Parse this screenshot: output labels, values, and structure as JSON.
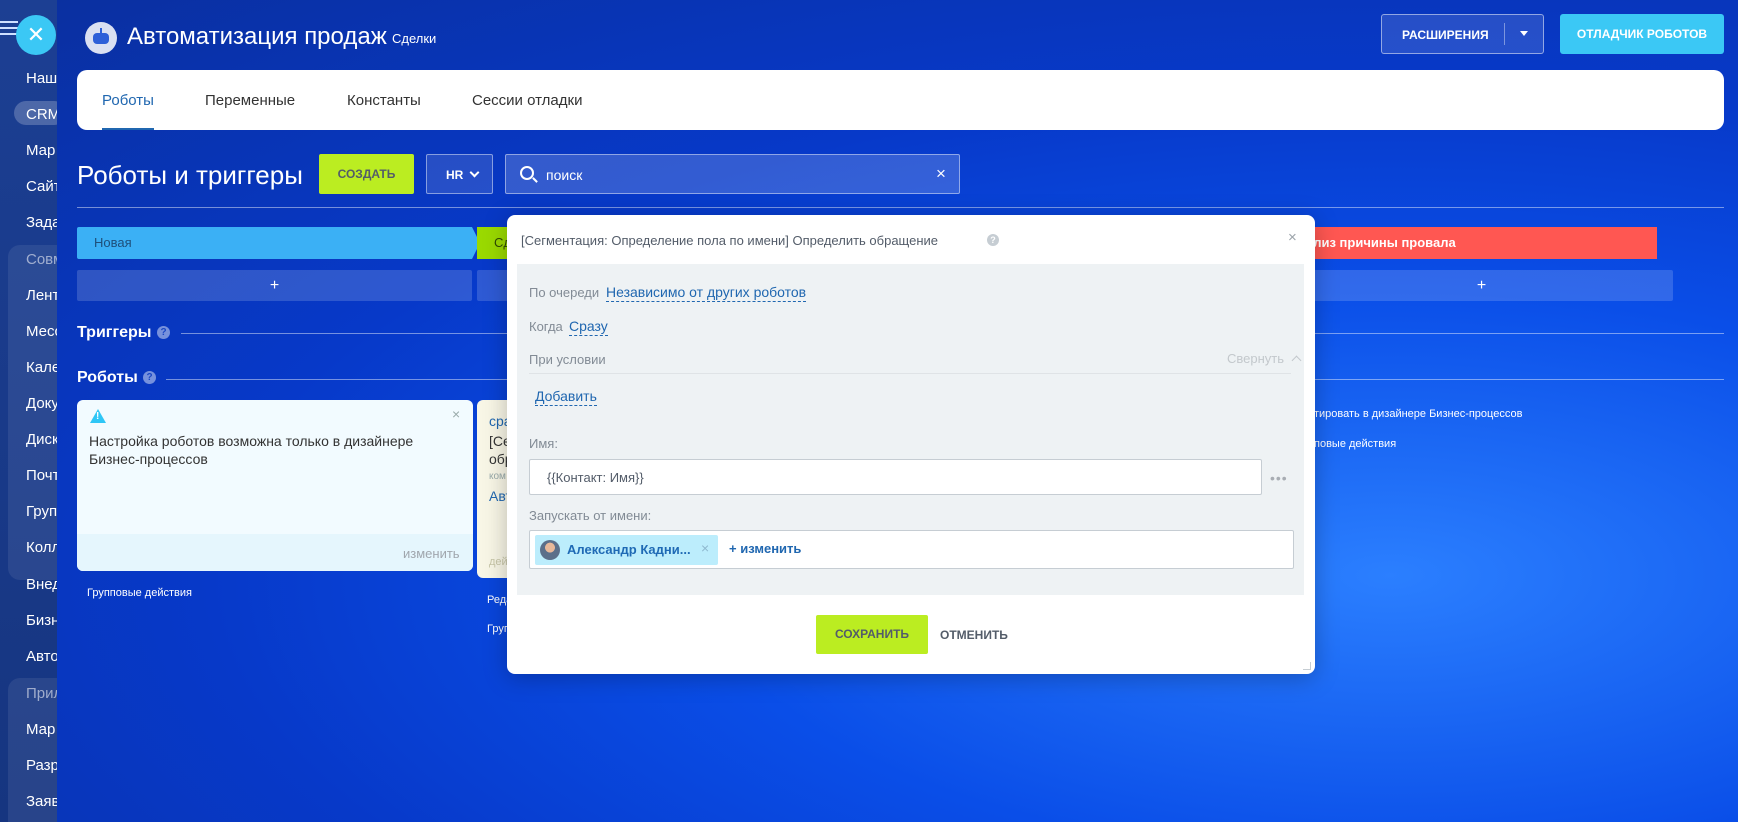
{
  "sidebar": {
    "items": [
      {
        "label": "Наш",
        "top": 0
      },
      {
        "label": "CRM"
      },
      {
        "label": "Мар"
      },
      {
        "label": "Сайт"
      },
      {
        "label": "Зада"
      },
      {
        "label": "Совм"
      },
      {
        "label": "Лент"
      },
      {
        "label": "Месс"
      },
      {
        "label": "Кале"
      },
      {
        "label": "Доку"
      },
      {
        "label": "Диск"
      },
      {
        "label": "Почт"
      },
      {
        "label": "Груп"
      },
      {
        "label": "Колл"
      },
      {
        "label": "Внед"
      },
      {
        "label": "Бизн"
      },
      {
        "label": "Авто"
      },
      {
        "label": "Прил"
      },
      {
        "label": "Мар"
      },
      {
        "label": "Разр"
      },
      {
        "label": "Заяв"
      }
    ]
  },
  "header": {
    "title": "Автоматизация продаж",
    "subtitle": "Сделки",
    "extensions_label": "РАСШИРЕНИЯ",
    "debugger_label": "ОТЛАДЧИК РОБОТОВ"
  },
  "tabs": [
    {
      "label": "Роботы",
      "active": true
    },
    {
      "label": "Переменные"
    },
    {
      "label": "Константы"
    },
    {
      "label": "Сессии отладки"
    }
  ],
  "toolbar": {
    "page_title": "Роботы и триггеры",
    "create_label": "СОЗДАТЬ",
    "filter_label": "HR",
    "search_placeholder": "поиск"
  },
  "stages": {
    "new": "Новая",
    "second_partial": "Сд",
    "failure": "ализ причины провала",
    "add": "+"
  },
  "sections": {
    "triggers": "Триггеры",
    "robots": "Роботы",
    "help": "?"
  },
  "card": {
    "text": "Настройка роботов возможна только в дизайнере Бизнес-процессов",
    "edit_label": "изменить",
    "group_actions": "Групповые действия"
  },
  "card2": {
    "line1": "сра",
    "line2": "[Се",
    "line3": "обр",
    "line4": "ком",
    "line5": "Авт",
    "foot": "дей",
    "below1": "Реда",
    "below2": "Груп"
  },
  "right_column": {
    "edit_in_designer": "тировать в дизайнере Бизнес-процессов",
    "group_actions": "повые действия"
  },
  "modal": {
    "title": "[Сегментация: Определение пола по имени] Определить обращение",
    "order_label": "По очереди",
    "order_value": "Независимо от других роботов",
    "when_label": "Когда",
    "when_value": "Сразу",
    "condition_label": "При условии",
    "collapse_label": "Свернуть",
    "add_label": "Добавить",
    "name_label": "Имя:",
    "name_value": "{{Контакт: Имя}}",
    "run_as_label": "Запускать от имени:",
    "user_name": "Александр Кадни...",
    "change_label": "изменить",
    "save_label": "СОХРАНИТЬ",
    "cancel_label": "ОТМЕНИТЬ"
  },
  "colors": {
    "accent": "#2067b0",
    "create_button": "#bbed21",
    "debug_button": "#3bc8f5",
    "stage_new": "#3bb0f5",
    "stage_failure": "#ff5752"
  }
}
